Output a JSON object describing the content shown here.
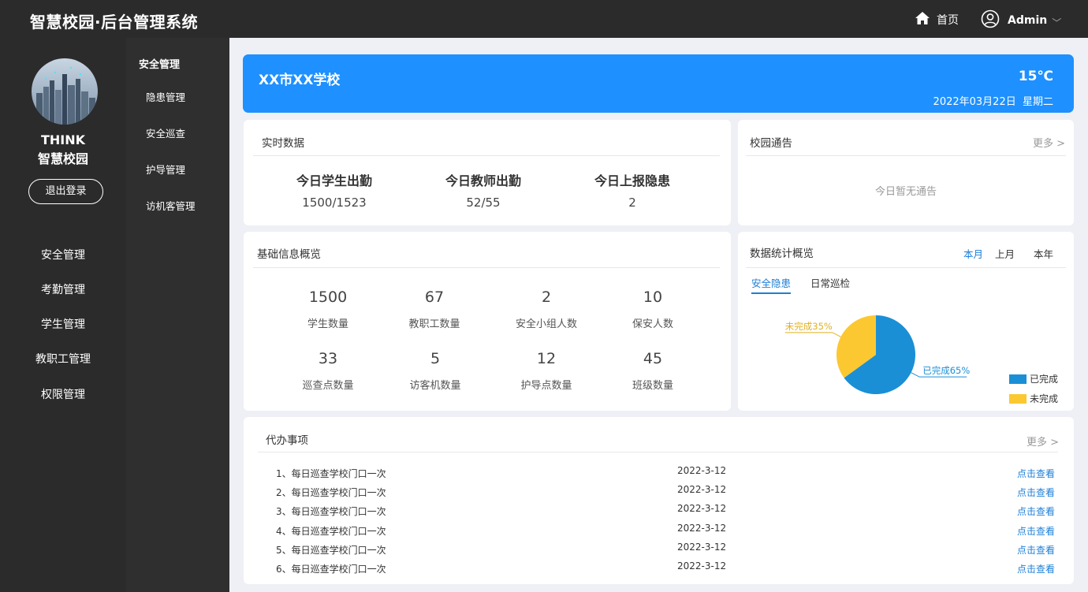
{
  "app": {
    "title": "智慧校园·后台管理系统"
  },
  "header": {
    "home_label": "首页",
    "user_name": "Admin",
    "home_icon": "home-icon",
    "user_icon": "user-circle-icon"
  },
  "sidebar": {
    "brand_line1": "THINK",
    "brand_line2": "智慧校园",
    "logout_label": "退出登录",
    "items": [
      "安全管理",
      "考勤管理",
      "学生管理",
      "教职工管理",
      "权限管理"
    ]
  },
  "subnav": {
    "title": "安全管理",
    "items": [
      "隐患管理",
      "安全巡查",
      "护导管理",
      "访机客管理"
    ]
  },
  "banner": {
    "school": "XX市XX学校",
    "temperature": "15℃",
    "date": "2022年03月22日",
    "weekday": "星期二"
  },
  "realtime": {
    "title": "实时数据",
    "stats": [
      {
        "label": "今日学生出勤",
        "value": "1500/1523"
      },
      {
        "label": "今日教师出勤",
        "value": "52/55"
      },
      {
        "label": "今日上报隐患",
        "value": "2"
      }
    ]
  },
  "notice": {
    "title": "校园通告",
    "more": "更多 >",
    "empty": "今日暂无通告"
  },
  "basic_info": {
    "title": "基础信息概览",
    "items": [
      {
        "num": "1500",
        "label": "学生数量"
      },
      {
        "num": "67",
        "label": "教职工数量"
      },
      {
        "num": "2",
        "label": "安全小组人数"
      },
      {
        "num": "10",
        "label": "保安人数"
      },
      {
        "num": "33",
        "label": "巡查点数量"
      },
      {
        "num": "5",
        "label": "访客机数量"
      },
      {
        "num": "12",
        "label": "护导点数量"
      },
      {
        "num": "45",
        "label": "班级数量"
      }
    ]
  },
  "stats_overview": {
    "title": "数据统计概览",
    "periods": [
      "本月",
      "上月",
      "本年"
    ],
    "active_period": "本月",
    "tabs": [
      "安全隐患",
      "日常巡检"
    ],
    "active_tab": "安全隐患",
    "legend": [
      "已完成",
      "未完成"
    ],
    "labels": [
      "已完成65%",
      "未完成35%"
    ]
  },
  "chart_data": {
    "type": "pie",
    "categories": [
      "已完成",
      "未完成"
    ],
    "values": [
      65,
      35
    ],
    "colors": [
      "#1a8fd6",
      "#fcc831"
    ]
  },
  "todo": {
    "title": "代办事项",
    "more": "更多 >",
    "rows": [
      {
        "text": "1、每日巡查学校门口一次",
        "date": "2022-3-12",
        "action": "点击查看"
      },
      {
        "text": "2、每日巡查学校门口一次",
        "date": "2022-3-12",
        "action": "点击查看"
      },
      {
        "text": "3、每日巡查学校门口一次",
        "date": "2022-3-12",
        "action": "点击查看"
      },
      {
        "text": "4、每日巡查学校门口一次",
        "date": "2022-3-12",
        "action": "点击查看"
      },
      {
        "text": "5、每日巡查学校门口一次",
        "date": "2022-3-12",
        "action": "点击查看"
      },
      {
        "text": "6、每日巡查学校门口一次",
        "date": "2022-3-12",
        "action": "点击查看"
      }
    ]
  }
}
